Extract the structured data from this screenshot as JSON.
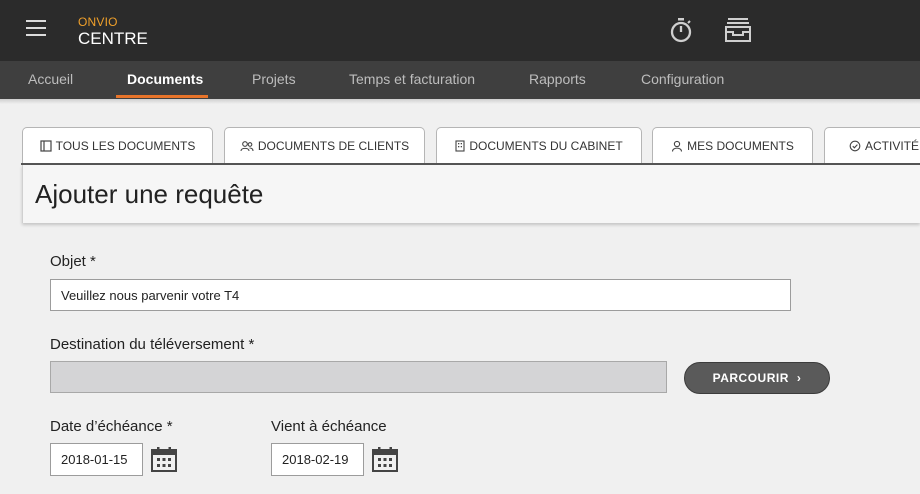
{
  "header": {
    "brand_top": "ONVIO",
    "brand_bottom": "CENTRE",
    "icons": [
      "menu-icon",
      "stopwatch-icon",
      "inbox-icon"
    ]
  },
  "nav": {
    "items": [
      {
        "label": "Accueil",
        "active": false
      },
      {
        "label": "Documents",
        "active": true
      },
      {
        "label": "Projets",
        "active": false
      },
      {
        "label": "Temps et facturation",
        "active": false
      },
      {
        "label": "Rapports",
        "active": false
      },
      {
        "label": "Configuration",
        "active": false
      }
    ],
    "accent_color": "#e8742a"
  },
  "tabs": [
    {
      "label": "TOUS LES DOCUMENTS",
      "icon": "documents-icon"
    },
    {
      "label": "DOCUMENTS DE CLIENTS",
      "icon": "clients-icon"
    },
    {
      "label": "DOCUMENTS DU CABINET",
      "icon": "building-icon"
    },
    {
      "label": "MES DOCUMENTS",
      "icon": "user-icon"
    },
    {
      "label": "ACTIVITÉ F",
      "icon": "activity-icon"
    }
  ],
  "page": {
    "title": "Ajouter une requête"
  },
  "form": {
    "subject_label": "Objet *",
    "subject_value": "Veuillez nous parvenir votre T4",
    "destination_label": "Destination du téléversement *",
    "destination_value": "",
    "browse_label": "PARCOURIR",
    "due_date_label": "Date d’échéance *",
    "due_date_value": "2018-01-15",
    "expires_label": "Vient à échéance",
    "expires_value": "2018-02-19"
  }
}
